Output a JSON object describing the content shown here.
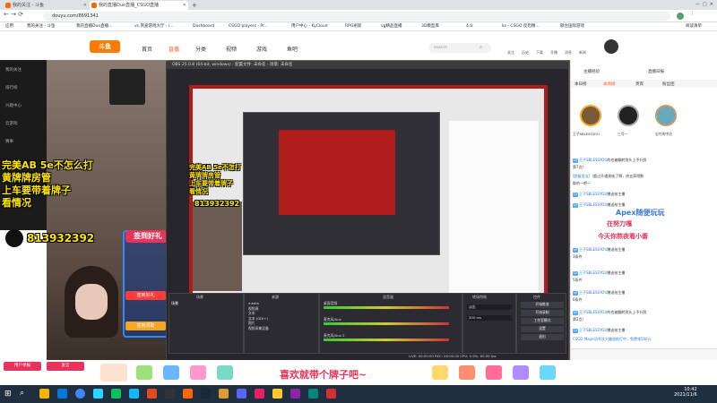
{
  "browser": {
    "tabs": [
      {
        "label": "我的关注 - 斗鱼"
      },
      {
        "label": "我的直播Duo直播_CSGO直播"
      },
      {
        "label": ""
      }
    ],
    "url": "douyu.com/8691341",
    "bookmarks": [
      "应用",
      "我的关注 - 斗鱼",
      "我的直播Duo直播...",
      "vs.简爱游戏大厅 - i...",
      "Dashboard",
      "CSGO players - Pr...",
      "用户中心 - KyCloud",
      "RPG刷新",
      "vg精品直播",
      "3D模型库",
      "4.6",
      "ks - CSGO 反恐精...",
      "联合国际游戏",
      "阅读清单"
    ]
  },
  "site": {
    "nav": [
      "首页",
      "直播",
      "分类",
      "视频",
      "游戏",
      "鱼吧"
    ],
    "search_placeholder": "search",
    "header_icons": [
      "关注",
      "历史",
      "下载",
      "开播",
      "消息",
      "新闻"
    ]
  },
  "sidebar": {
    "items": [
      "我的关注",
      "排行榜",
      "兴趣中心",
      "云游戏",
      "赛事"
    ]
  },
  "overlay": {
    "lines": [
      "完美AB 5e不怎么打",
      "黄牌牌房管",
      "上车要带着牌子",
      "看情况"
    ],
    "qq": "813932392",
    "sign": "签到好礼",
    "bottom": "喜欢就带个牌子吧~"
  },
  "obs": {
    "title": "OBS 25.0.8 (64-bit, windows) - 配置文件: 未命名 - 场景: 未命名",
    "panels": [
      "场景",
      "来源",
      "混音器",
      "转场特效",
      "控件"
    ],
    "scene": "场景",
    "sources": [
      "media",
      "视频源",
      "文本",
      "文本 (GDI+)",
      "图片",
      "视频采集设备"
    ],
    "mixer": [
      "桌面音频",
      "麦克风/Aux",
      "麦克风/Aux 2"
    ],
    "transition": "淡出",
    "duration": "300 ms",
    "controls": [
      "开始推流",
      "开始录制",
      "工作室模式",
      "设置",
      "退出"
    ],
    "status": "LIVE: 00:00:00  REC: 00:00:00  CPU: 0.9%, 60.00 fps"
  },
  "chat": {
    "header": [
      "主播经验",
      "直播日报"
    ],
    "tabs": [
      "本日榜",
      "本周榜",
      "贵宾",
      "粉丝团"
    ],
    "top3": [
      "王子SBLESSYOU",
      "三号一",
      "忘竹的中冶"
    ],
    "ad_lines": [
      "Apex随便玩玩",
      "在努力嘎",
      "今天你熬夜看小番"
    ],
    "messages": [
      {
        "user": "王子SBLESSYOU",
        "text": "的也被翻转到头上不升到"
      },
      {
        "user": "",
        "text": "第7点）"
      },
      {
        "user": "[超级用法]",
        "text": "（超过开通贵族了啊，终去获得数"
      },
      {
        "user": "",
        "text": "群的一吧~"
      },
      {
        "user": "王子SBLESSYOU",
        "text": "赠送给主播"
      },
      {
        "user": "王子SBLESSYOU",
        "text": "赠送给主播"
      },
      {
        "user": "王子SBLESSYOU",
        "text": "赠送给主播"
      },
      {
        "user": "",
        "text": "3条件"
      },
      {
        "user": "王子SBLESSYOU",
        "text": "赠送给主播"
      },
      {
        "user": "",
        "text": "5条件"
      },
      {
        "user": "王子SBLESSYOU",
        "text": "赠送给主播"
      },
      {
        "user": "",
        "text": "6条件"
      },
      {
        "user": "王子SBLESSYOU",
        "text": "的也被翻转到头上不升到"
      },
      {
        "user": "",
        "text": "第2点）"
      },
      {
        "user": "王子SBLESSYOU",
        "text": "赠送给主播"
      },
      {
        "user": "",
        "text": "CSGO Major冠军队兴趣战前打中，免费领500元"
      }
    ]
  },
  "buttons": [
    "用户举报",
    "发言"
  ],
  "taskbar": {
    "time": "10:42",
    "date": "2021/11/6"
  }
}
